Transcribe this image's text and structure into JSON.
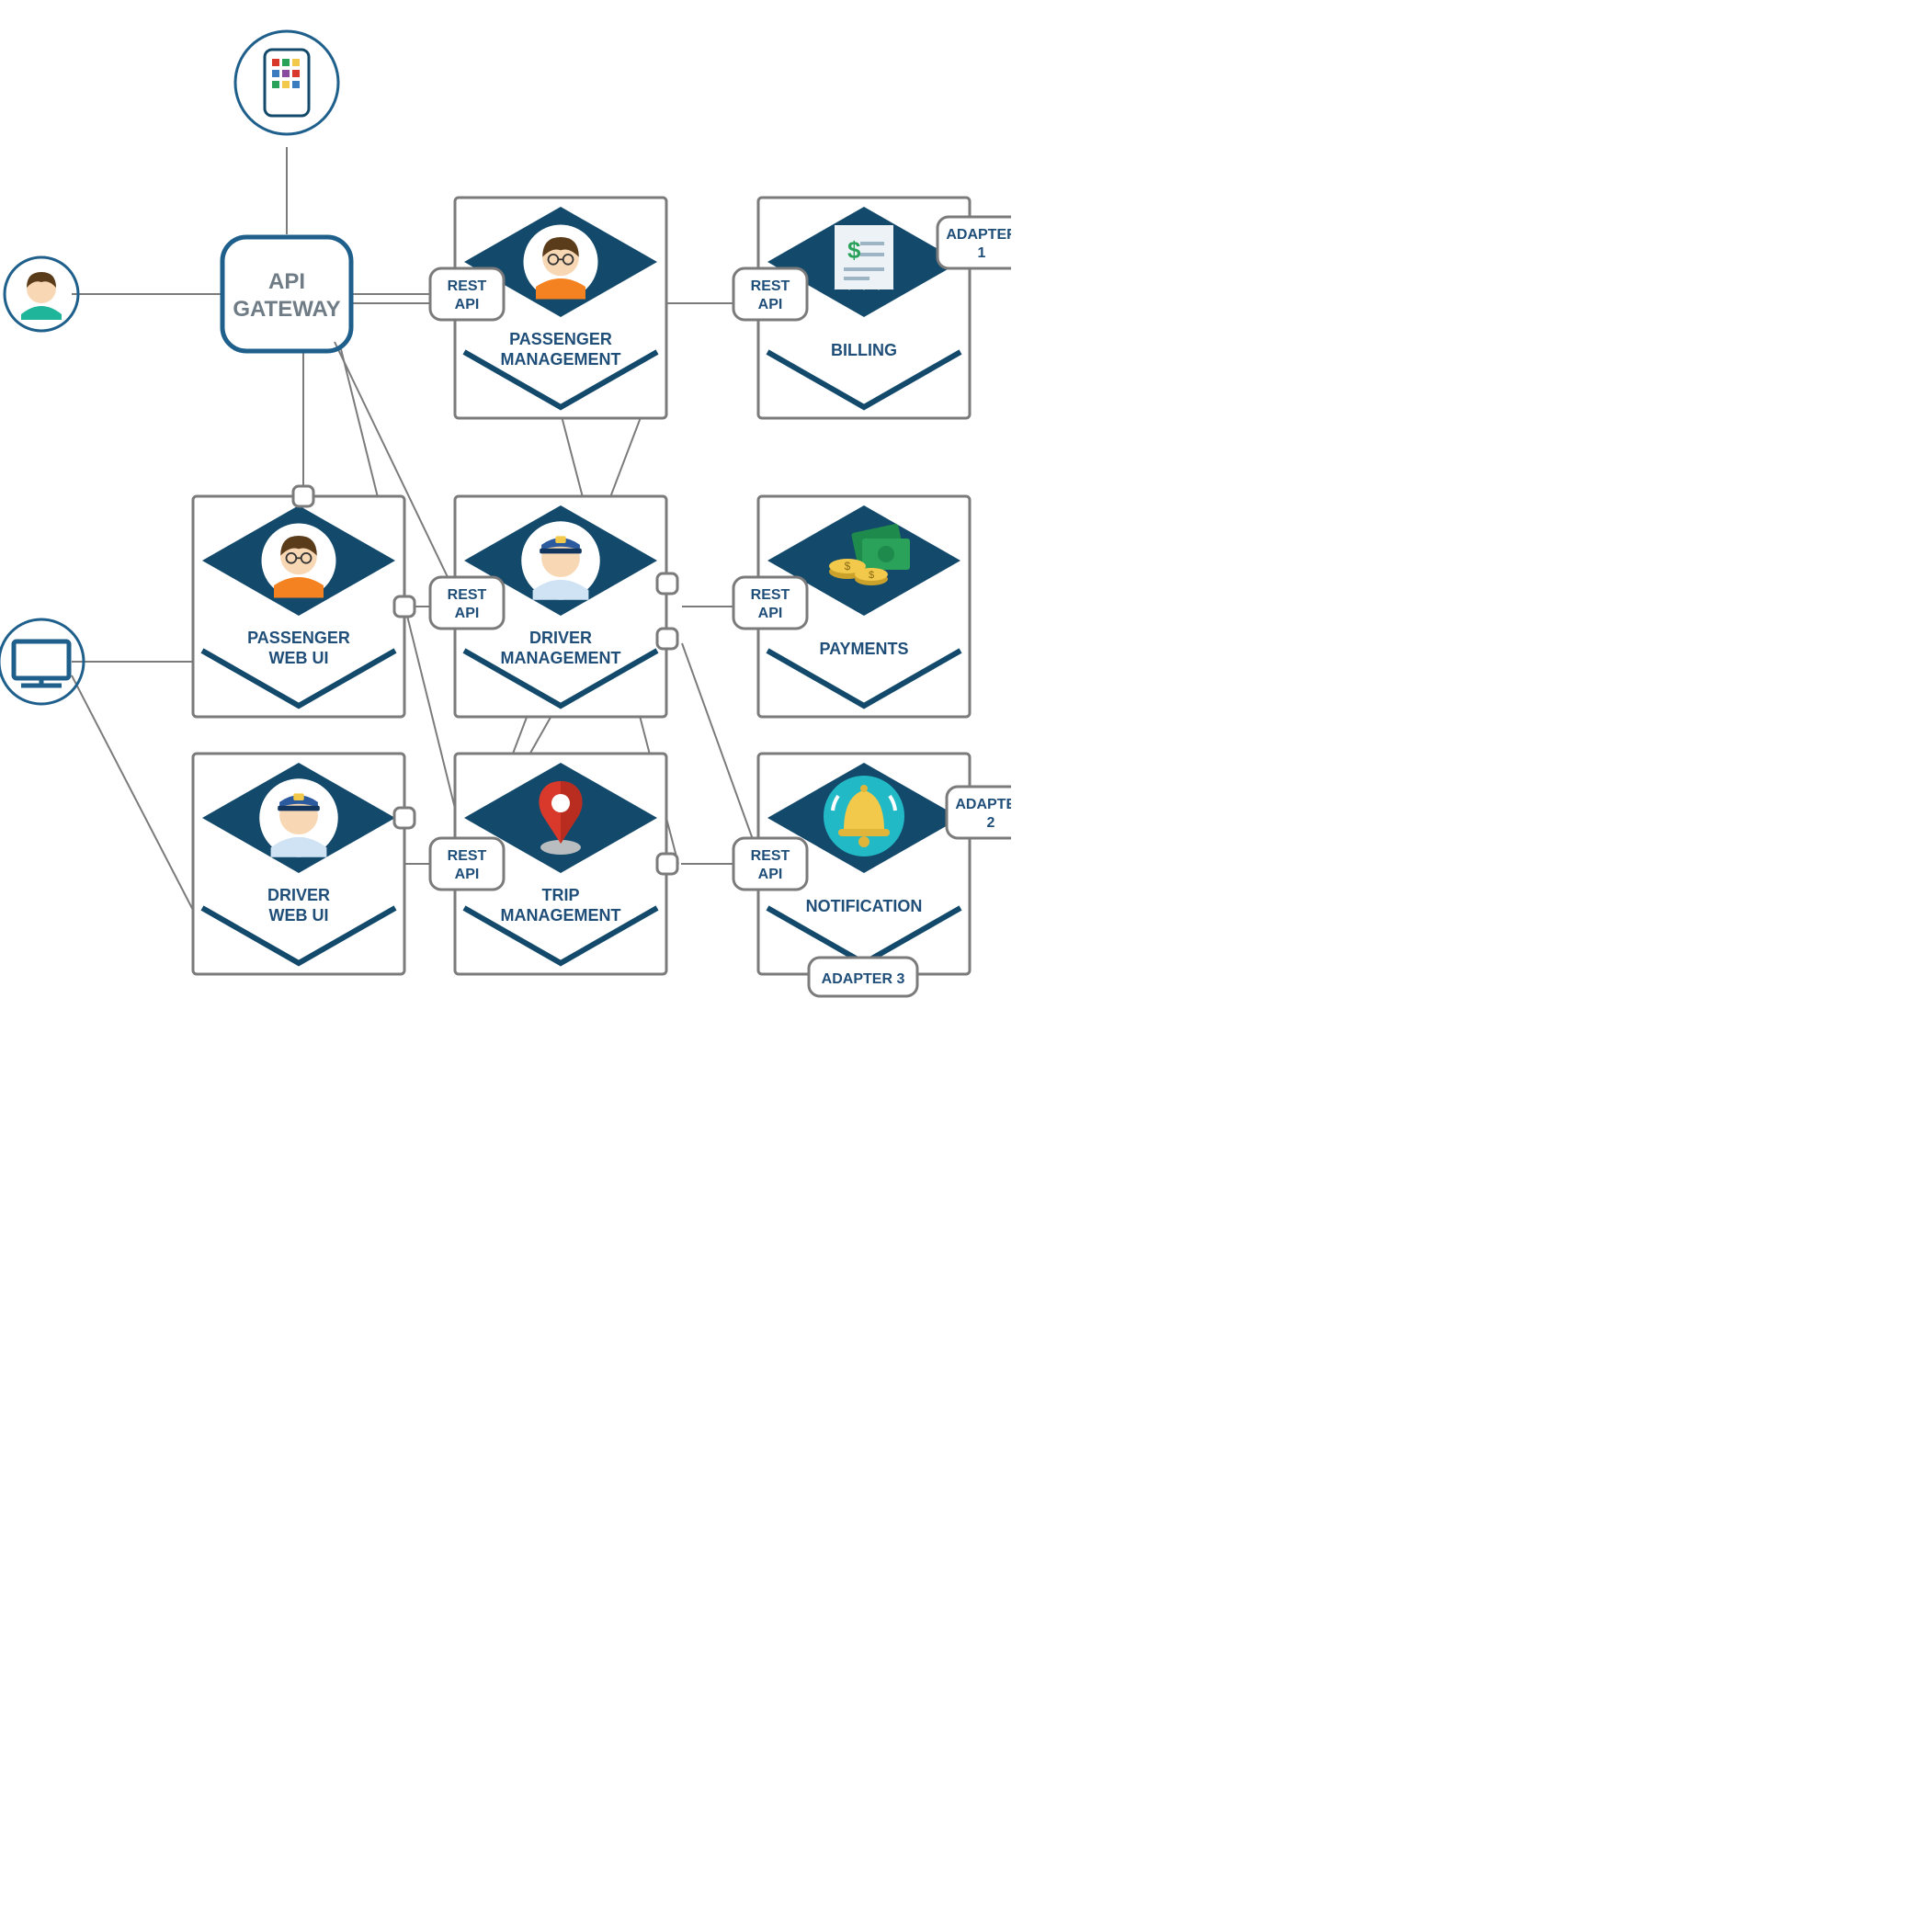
{
  "gateway": {
    "line1": "API",
    "line2": "GATEWAY"
  },
  "services": {
    "passenger_mgmt": {
      "line1": "PASSENGER",
      "line2": "MANAGEMENT"
    },
    "billing": {
      "line1": "BILLING"
    },
    "passenger_web": {
      "line1": "PASSENGER",
      "line2": "WEB UI"
    },
    "driver_mgmt": {
      "line1": "DRIVER",
      "line2": "MANAGEMENT"
    },
    "payments": {
      "line1": "PAYMENTS"
    },
    "driver_web": {
      "line1": "DRIVER",
      "line2": "WEB UI"
    },
    "trip_mgmt": {
      "line1": "TRIP",
      "line2": "MANAGEMENT"
    },
    "notification": {
      "line1": "NOTIFICATION"
    }
  },
  "badges": {
    "rest": {
      "line1": "REST",
      "line2": "API"
    },
    "adapter1": {
      "line1": "ADAPTER",
      "line2": "1"
    },
    "adapter2": {
      "line1": "ADAPTER",
      "line2": "2"
    },
    "adapter3": {
      "line1": "ADAPTER 3"
    }
  },
  "colors": {
    "border": "#7b7b7b",
    "steel": "#1f4e79",
    "navy": "#13496b",
    "accent": "#1f5f8b"
  }
}
